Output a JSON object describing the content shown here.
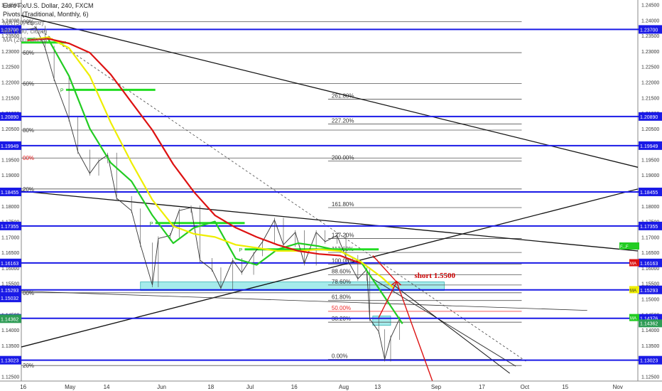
{
  "header": {
    "symbol_line": "Euro Fx/U.S. Dollar, 240, FXCM",
    "pivots_line": "Pivots (Traditional, Monthly, 6)",
    "ma_lines": [
      "MA (50, close)",
      "MA (100, close)",
      "MA (200, close)"
    ]
  },
  "chart_data": {
    "type": "line",
    "instrument": "Euro Fx/U.S. Dollar",
    "timeframe": "240",
    "source": "FXCM",
    "y_ticks": [
      "1.24500",
      "1.24000",
      "1.23500",
      "1.23000",
      "1.22500",
      "1.22000",
      "1.21500",
      "1.21000",
      "1.20500",
      "1.20000",
      "1.19500",
      "1.19000",
      "1.18500",
      "1.18000",
      "1.17500",
      "1.17000",
      "1.16500",
      "1.16000",
      "1.15500",
      "1.15000",
      "1.14500",
      "1.14000",
      "1.13500",
      "1.13000",
      "1.12500"
    ],
    "x_ticks": [
      {
        "label": "16",
        "date": "2018-04-16"
      },
      {
        "label": "May",
        "date": "2018-05-01"
      },
      {
        "label": "14",
        "date": "2018-05-14"
      },
      {
        "label": "Jun",
        "date": "2018-06-01"
      },
      {
        "label": "18",
        "date": "2018-06-18"
      },
      {
        "label": "Jul",
        "date": "2018-07-01"
      },
      {
        "label": "16",
        "date": "2018-07-16"
      },
      {
        "label": "Aug",
        "date": "2018-08-01"
      },
      {
        "label": "13",
        "date": "2018-08-13"
      },
      {
        "label": "Sep",
        "date": "2018-09-01"
      },
      {
        "label": "17",
        "date": "2018-09-17"
      },
      {
        "label": "Oct",
        "date": "2018-10-01"
      },
      {
        "label": "15",
        "date": "2018-10-15"
      },
      {
        "label": "Nov",
        "date": "2018-11-01"
      }
    ],
    "x_range": [
      "2018-04-15",
      "2018-11-08"
    ],
    "y_range": [
      1.1235,
      1.2465
    ],
    "price": [
      [
        "2018-04-17",
        1.237
      ],
      [
        "2018-04-20",
        1.2375
      ],
      [
        "2018-04-23",
        1.231
      ],
      [
        "2018-04-26",
        1.221
      ],
      [
        "2018-05-01",
        1.208
      ],
      [
        "2018-05-04",
        1.1975
      ],
      [
        "2018-05-08",
        1.1905
      ],
      [
        "2018-05-11",
        1.1945
      ],
      [
        "2018-05-14",
        1.1965
      ],
      [
        "2018-05-17",
        1.1825
      ],
      [
        "2018-05-22",
        1.1785
      ],
      [
        "2018-05-25",
        1.1675
      ],
      [
        "2018-05-29",
        1.1545
      ],
      [
        "2018-05-31",
        1.1695
      ],
      [
        "2018-06-04",
        1.1705
      ],
      [
        "2018-06-07",
        1.1785
      ],
      [
        "2018-06-11",
        1.1795
      ],
      [
        "2018-06-14",
        1.1625
      ],
      [
        "2018-06-18",
        1.1595
      ],
      [
        "2018-06-21",
        1.1535
      ],
      [
        "2018-06-25",
        1.1625
      ],
      [
        "2018-06-28",
        1.1585
      ],
      [
        "2018-07-02",
        1.1645
      ],
      [
        "2018-07-05",
        1.1685
      ],
      [
        "2018-07-09",
        1.1755
      ],
      [
        "2018-07-12",
        1.1675
      ],
      [
        "2018-07-16",
        1.1715
      ],
      [
        "2018-07-19",
        1.1615
      ],
      [
        "2018-07-23",
        1.1715
      ],
      [
        "2018-07-26",
        1.1685
      ],
      [
        "2018-07-30",
        1.1705
      ],
      [
        "2018-08-02",
        1.1635
      ],
      [
        "2018-08-06",
        1.1565
      ],
      [
        "2018-08-09",
        1.1595
      ],
      [
        "2018-08-10",
        1.1435
      ],
      [
        "2018-08-13",
        1.1395
      ],
      [
        "2018-08-15",
        1.1305
      ],
      [
        "2018-08-17",
        1.1375
      ],
      [
        "2018-08-20",
        1.1436
      ]
    ],
    "series": [
      {
        "name": "MA (50, close)",
        "color": "#22cc22",
        "values": [
          [
            "2018-04-17",
            1.234
          ],
          [
            "2018-04-24",
            1.234
          ],
          [
            "2018-05-01",
            1.222
          ],
          [
            "2018-05-08",
            1.205
          ],
          [
            "2018-05-15",
            1.194
          ],
          [
            "2018-05-22",
            1.188
          ],
          [
            "2018-05-29",
            1.177
          ],
          [
            "2018-06-05",
            1.168
          ],
          [
            "2018-06-12",
            1.173
          ],
          [
            "2018-06-19",
            1.175
          ],
          [
            "2018-06-26",
            1.163
          ],
          [
            "2018-07-03",
            1.161
          ],
          [
            "2018-07-10",
            1.166
          ],
          [
            "2018-07-17",
            1.168
          ],
          [
            "2018-07-24",
            1.167
          ],
          [
            "2018-07-31",
            1.1655
          ],
          [
            "2018-08-07",
            1.162
          ],
          [
            "2018-08-14",
            1.152
          ],
          [
            "2018-08-21",
            1.142
          ]
        ]
      },
      {
        "name": "MA (100, close)",
        "color": "#eeee00",
        "values": [
          [
            "2018-04-17",
            1.2335
          ],
          [
            "2018-04-24",
            1.2345
          ],
          [
            "2018-05-01",
            1.231
          ],
          [
            "2018-05-08",
            1.222
          ],
          [
            "2018-05-15",
            1.207
          ],
          [
            "2018-05-22",
            1.194
          ],
          [
            "2018-05-29",
            1.182
          ],
          [
            "2018-06-05",
            1.1735
          ],
          [
            "2018-06-12",
            1.171
          ],
          [
            "2018-06-19",
            1.17
          ],
          [
            "2018-06-26",
            1.1675
          ],
          [
            "2018-07-03",
            1.1665
          ],
          [
            "2018-07-10",
            1.1655
          ],
          [
            "2018-07-17",
            1.1655
          ],
          [
            "2018-07-24",
            1.166
          ],
          [
            "2018-07-31",
            1.1655
          ],
          [
            "2018-08-07",
            1.162
          ],
          [
            "2018-08-14",
            1.157
          ],
          [
            "2018-08-18",
            1.1535
          ]
        ]
      },
      {
        "name": "MA (200, close)",
        "color": "#dd1111",
        "values": [
          [
            "2018-04-17",
            1.2335
          ],
          [
            "2018-04-24",
            1.234
          ],
          [
            "2018-05-01",
            1.2325
          ],
          [
            "2018-05-08",
            1.2295
          ],
          [
            "2018-05-15",
            1.2225
          ],
          [
            "2018-05-22",
            1.2135
          ],
          [
            "2018-05-29",
            1.2045
          ],
          [
            "2018-06-05",
            1.1935
          ],
          [
            "2018-06-12",
            1.1845
          ],
          [
            "2018-06-19",
            1.177
          ],
          [
            "2018-06-26",
            1.173
          ],
          [
            "2018-07-03",
            1.17
          ],
          [
            "2018-07-10",
            1.1675
          ],
          [
            "2018-07-17",
            1.1655
          ],
          [
            "2018-07-24",
            1.1645
          ],
          [
            "2018-07-31",
            1.164
          ],
          [
            "2018-08-07",
            1.1615
          ]
        ]
      }
    ],
    "horizontal_levels": [
      {
        "label": "1.23700",
        "value": 1.237
      },
      {
        "label": "1.20890",
        "value": 1.2089
      },
      {
        "label": "1.19949",
        "value": 1.19949
      },
      {
        "label": "1.18455",
        "value": 1.18455
      },
      {
        "label": "1.17355",
        "value": 1.17355
      },
      {
        "label": "1.16163",
        "value": 1.16163
      },
      {
        "label": "1.15293",
        "value": 1.15293
      },
      {
        "label": "1.14376",
        "value": 1.14376
      },
      {
        "label": "1.13023",
        "value": 1.13023
      }
    ],
    "pivot_levels": [
      {
        "label": "00%",
        "value": 1.2395
      },
      {
        "label": "60%",
        "value": 1.2295
      },
      {
        "label": "60%",
        "value": 1.2195
      },
      {
        "label": "80%",
        "value": 1.2045
      },
      {
        "label": "00%",
        "value": 1.1955
      },
      {
        "label": "20%",
        "value": 1.1855
      },
      {
        "label": "00%",
        "value": 1.152
      },
      {
        "label": "20%",
        "value": 1.1285
      }
    ],
    "fib_levels": [
      {
        "label": "261.80%",
        "value": 1.2145
      },
      {
        "label": "227.20%",
        "value": 1.2065
      },
      {
        "label": "200.00%",
        "value": 1.1945
      },
      {
        "label": "161.80%",
        "value": 1.1795
      },
      {
        "label": "127.20%",
        "value": 1.1695
      },
      {
        "label": "113.60%",
        "value": 1.165
      },
      {
        "label": "100.00%",
        "value": 1.1612
      },
      {
        "label": "88.60%",
        "value": 1.1578
      },
      {
        "label": "78.60%",
        "value": 1.1545
      },
      {
        "label": "61.80%",
        "value": 1.1495
      },
      {
        "label": "50.00%",
        "value": 1.146
      },
      {
        "label": "38.20%",
        "value": 1.1425
      },
      {
        "label": "0.00%",
        "value": 1.1305
      }
    ],
    "pivot_markers": [
      {
        "label": "P",
        "value": 1.2175,
        "start": "2018-04-30",
        "end": "2018-05-30"
      },
      {
        "label": "P",
        "value": 1.1745,
        "start": "2018-05-30",
        "end": "2018-06-29"
      },
      {
        "label": "P",
        "value": 1.166,
        "start": "2018-06-29",
        "end": "2018-08-13"
      }
    ],
    "zones": [
      {
        "from": 1.1527,
        "to": 1.1555,
        "start": "2018-05-25",
        "end": "2018-09-04",
        "color": "#7fe3e3"
      },
      {
        "from": 1.1415,
        "to": 1.1445,
        "start": "2018-08-11",
        "end": "2018-08-17",
        "color": "#7fe3e3"
      }
    ],
    "annotation": {
      "text": "short 1.5500",
      "date": "2018-08-25",
      "value": 1.1568,
      "color": "#cc0000"
    },
    "right_badges": [
      {
        "text": "F...F",
        "value": 1.1671,
        "color": "#22cc22"
      },
      {
        "text": "MA",
        "value": 1.1617,
        "color": "#dd1111"
      },
      {
        "text": "MA",
        "value": 1.153,
        "color": "#eeee00"
      },
      {
        "text": "MA",
        "value": 1.144,
        "color": "#22cc22"
      }
    ],
    "last_price": {
      "label": "1.14362",
      "value": 1.14362,
      "color": "#2e9c55"
    },
    "left_labels": [
      {
        "label": "1.23700",
        "value": 1.237
      },
      {
        "label": "1.20890",
        "value": 1.2089
      },
      {
        "label": "1.19949",
        "value": 1.19949
      },
      {
        "label": "1.18455",
        "value": 1.18455
      },
      {
        "label": "1.17355",
        "value": 1.17355
      },
      {
        "label": "1.16163",
        "value": 1.16163
      },
      {
        "label": "1.15293",
        "value": 1.15293
      },
      {
        "label": "1.15032",
        "value": 1.15032
      },
      {
        "label": "1.14376",
        "value": 1.14376
      },
      {
        "label": "1.14362",
        "value": 1.14362
      },
      {
        "label": "1.13023",
        "value": 1.13023
      }
    ]
  }
}
